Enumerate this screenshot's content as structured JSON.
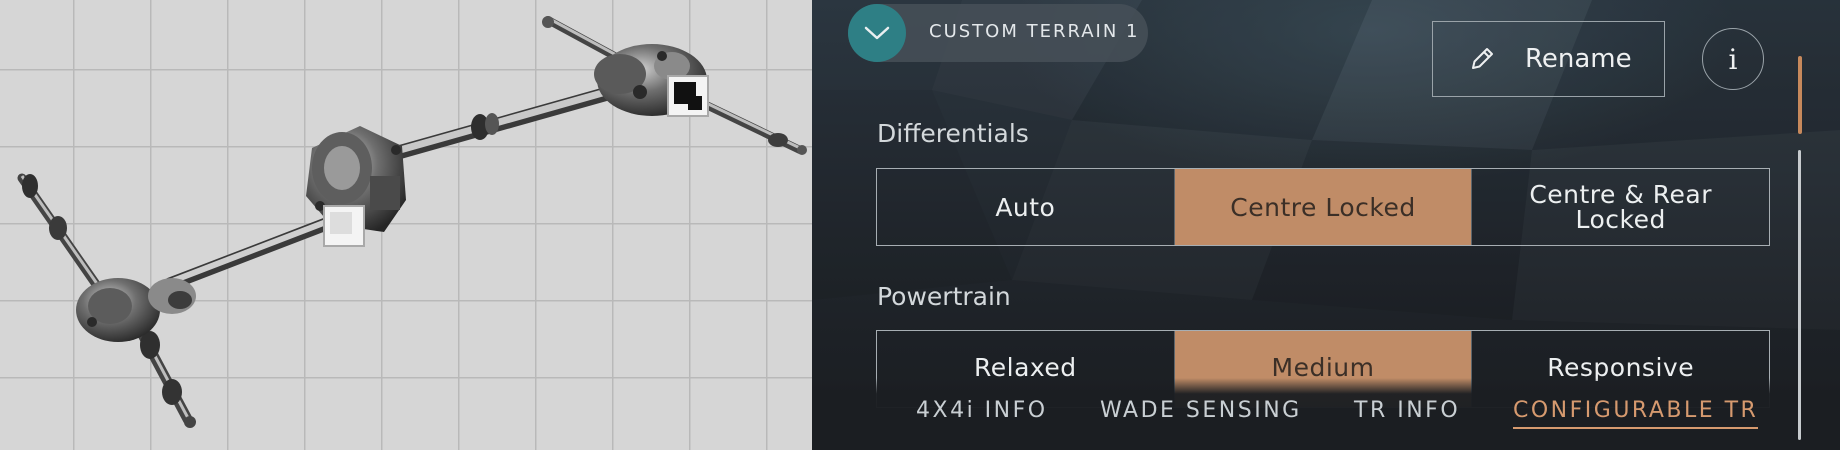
{
  "left_panel": {
    "drivetrain_icon": "awd-drivetrain-diagram",
    "front_diff_lock_indicator": "lock-square-icon",
    "centre_diff_lock_indicator": "lock-square-icon",
    "rear_diff_lock_indicator": "lock-square-icon"
  },
  "header": {
    "mode_toggle_icon": "chevron-down-icon",
    "mode_name": "CUSTOM TERRAIN 1",
    "rename_label": "Rename",
    "rename_icon": "pencil-icon",
    "info_label": "i"
  },
  "differentials": {
    "title": "Differentials",
    "options": [
      "Auto",
      "Centre Locked",
      "Centre & Rear\nLocked"
    ],
    "selected": "Centre Locked"
  },
  "powertrain": {
    "title": "Powertrain",
    "options": [
      "Relaxed",
      "Medium",
      "Responsive"
    ],
    "selected": "Medium"
  },
  "tabs": {
    "items": [
      "4X4i INFO",
      "WADE SENSING",
      "TR INFO",
      "CONFIGURABLE TR"
    ],
    "active": "CONFIGURABLE TR"
  },
  "colors": {
    "accent": "#c08c67",
    "toggle": "#2e7f85",
    "tab_active": "#d69a6f"
  }
}
